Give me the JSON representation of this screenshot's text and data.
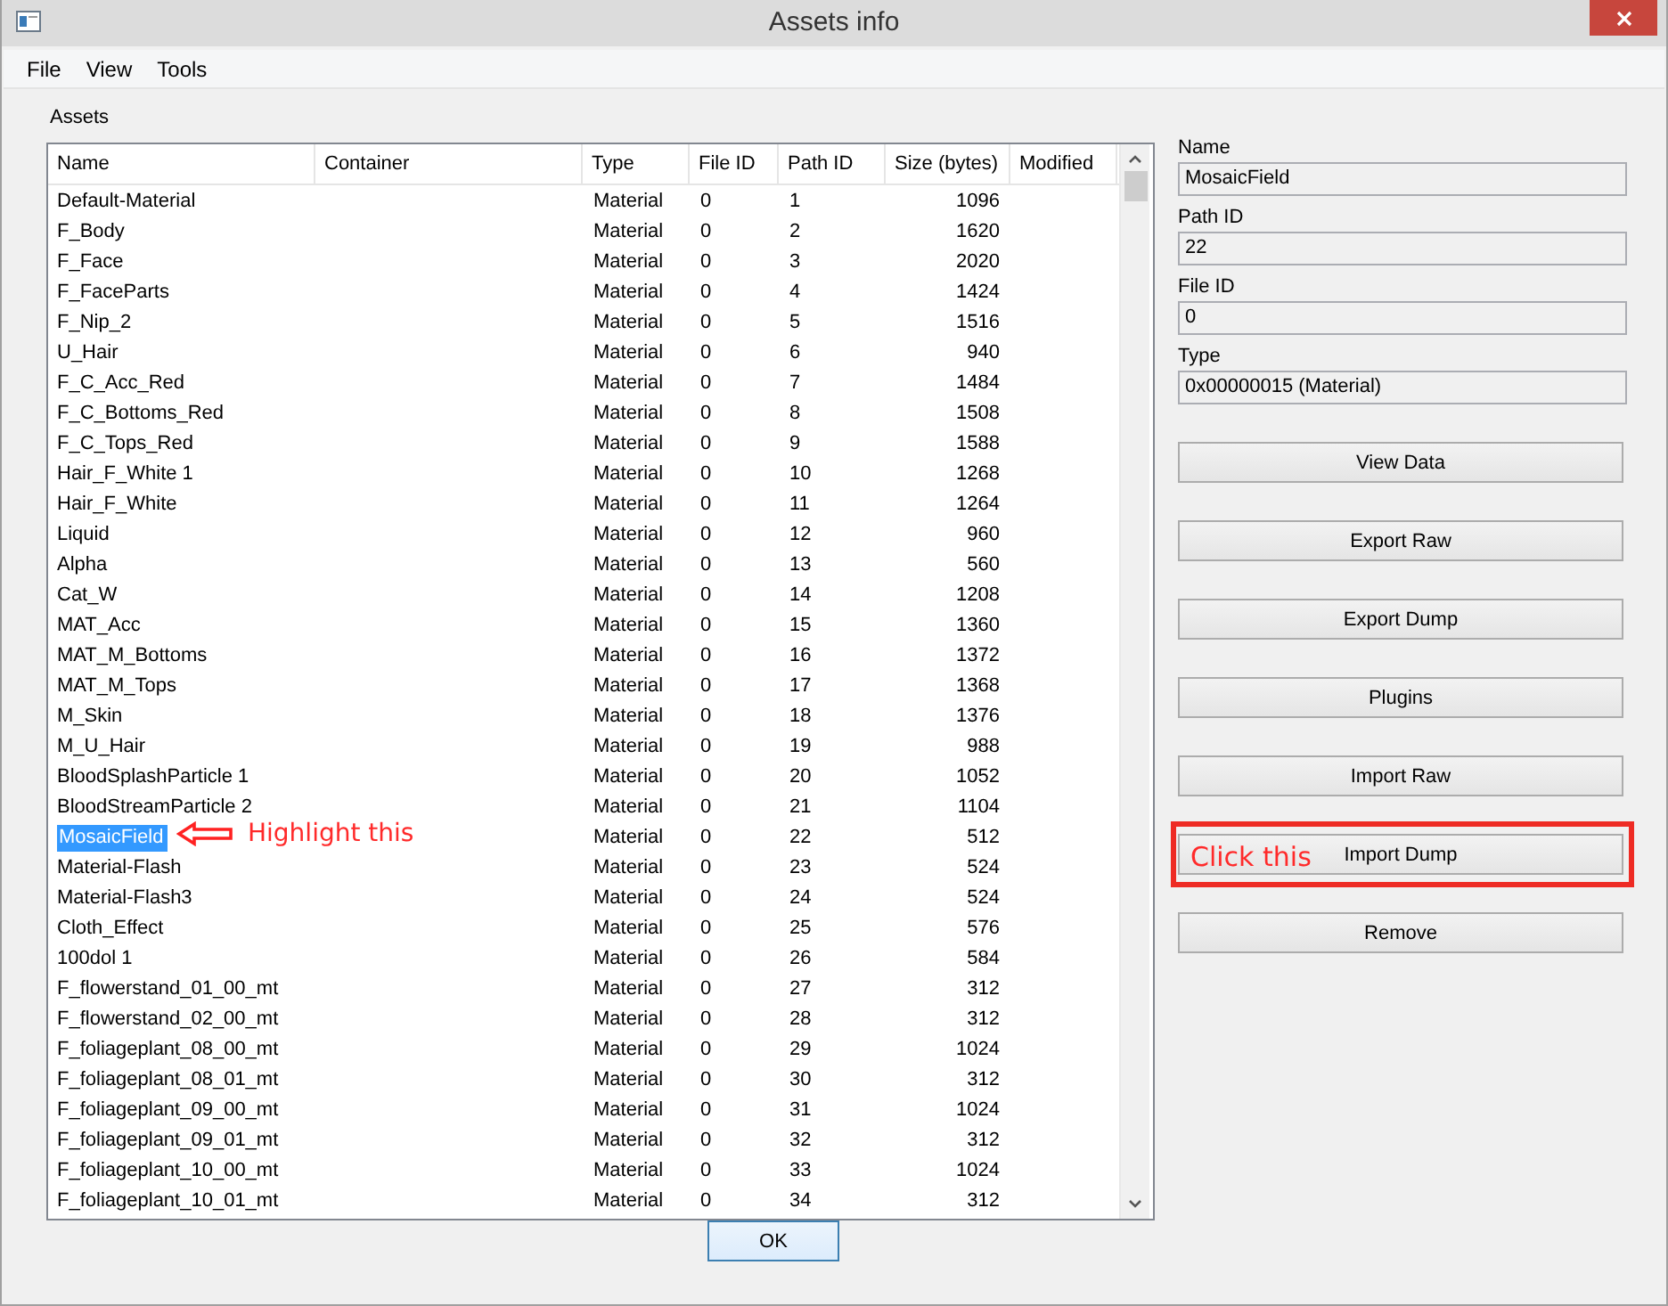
{
  "window": {
    "title": "Assets info"
  },
  "menu": [
    "File",
    "View",
    "Tools"
  ],
  "assets": {
    "label": "Assets",
    "columns": [
      "Name",
      "Container",
      "Type",
      "File ID",
      "Path ID",
      "Size (bytes)",
      "Modified"
    ],
    "rows": [
      {
        "name": "Default-Material",
        "type": "Material",
        "file_id": "0",
        "path_id": "1",
        "size": "1096",
        "selected": false
      },
      {
        "name": "F_Body",
        "type": "Material",
        "file_id": "0",
        "path_id": "2",
        "size": "1620",
        "selected": false
      },
      {
        "name": "F_Face",
        "type": "Material",
        "file_id": "0",
        "path_id": "3",
        "size": "2020",
        "selected": false
      },
      {
        "name": "F_FaceParts",
        "type": "Material",
        "file_id": "0",
        "path_id": "4",
        "size": "1424",
        "selected": false
      },
      {
        "name": "F_Nip_2",
        "type": "Material",
        "file_id": "0",
        "path_id": "5",
        "size": "1516",
        "selected": false
      },
      {
        "name": "U_Hair",
        "type": "Material",
        "file_id": "0",
        "path_id": "6",
        "size": "940",
        "selected": false
      },
      {
        "name": "F_C_Acc_Red",
        "type": "Material",
        "file_id": "0",
        "path_id": "7",
        "size": "1484",
        "selected": false
      },
      {
        "name": "F_C_Bottoms_Red",
        "type": "Material",
        "file_id": "0",
        "path_id": "8",
        "size": "1508",
        "selected": false
      },
      {
        "name": "F_C_Tops_Red",
        "type": "Material",
        "file_id": "0",
        "path_id": "9",
        "size": "1588",
        "selected": false
      },
      {
        "name": "Hair_F_White 1",
        "type": "Material",
        "file_id": "0",
        "path_id": "10",
        "size": "1268",
        "selected": false
      },
      {
        "name": "Hair_F_White",
        "type": "Material",
        "file_id": "0",
        "path_id": "11",
        "size": "1264",
        "selected": false
      },
      {
        "name": "Liquid",
        "type": "Material",
        "file_id": "0",
        "path_id": "12",
        "size": "960",
        "selected": false
      },
      {
        "name": "Alpha",
        "type": "Material",
        "file_id": "0",
        "path_id": "13",
        "size": "560",
        "selected": false
      },
      {
        "name": "Cat_W",
        "type": "Material",
        "file_id": "0",
        "path_id": "14",
        "size": "1208",
        "selected": false
      },
      {
        "name": "MAT_Acc",
        "type": "Material",
        "file_id": "0",
        "path_id": "15",
        "size": "1360",
        "selected": false
      },
      {
        "name": "MAT_M_Bottoms",
        "type": "Material",
        "file_id": "0",
        "path_id": "16",
        "size": "1372",
        "selected": false
      },
      {
        "name": "MAT_M_Tops",
        "type": "Material",
        "file_id": "0",
        "path_id": "17",
        "size": "1368",
        "selected": false
      },
      {
        "name": "M_Skin",
        "type": "Material",
        "file_id": "0",
        "path_id": "18",
        "size": "1376",
        "selected": false
      },
      {
        "name": "M_U_Hair",
        "type": "Material",
        "file_id": "0",
        "path_id": "19",
        "size": "988",
        "selected": false
      },
      {
        "name": "BloodSplashParticle 1",
        "type": "Material",
        "file_id": "0",
        "path_id": "20",
        "size": "1052",
        "selected": false
      },
      {
        "name": "BloodStreamParticle 2",
        "type": "Material",
        "file_id": "0",
        "path_id": "21",
        "size": "1104",
        "selected": false
      },
      {
        "name": "MosaicField",
        "type": "Material",
        "file_id": "0",
        "path_id": "22",
        "size": "512",
        "selected": true,
        "annotation": "Highlight this"
      },
      {
        "name": "Material-Flash",
        "type": "Material",
        "file_id": "0",
        "path_id": "23",
        "size": "524",
        "selected": false
      },
      {
        "name": "Material-Flash3",
        "type": "Material",
        "file_id": "0",
        "path_id": "24",
        "size": "524",
        "selected": false
      },
      {
        "name": "Cloth_Effect",
        "type": "Material",
        "file_id": "0",
        "path_id": "25",
        "size": "576",
        "selected": false
      },
      {
        "name": "100dol 1",
        "type": "Material",
        "file_id": "0",
        "path_id": "26",
        "size": "584",
        "selected": false
      },
      {
        "name": "F_flowerstand_01_00_mt",
        "type": "Material",
        "file_id": "0",
        "path_id": "27",
        "size": "312",
        "selected": false
      },
      {
        "name": "F_flowerstand_02_00_mt",
        "type": "Material",
        "file_id": "0",
        "path_id": "28",
        "size": "312",
        "selected": false
      },
      {
        "name": "F_foliageplant_08_00_mt",
        "type": "Material",
        "file_id": "0",
        "path_id": "29",
        "size": "1024",
        "selected": false
      },
      {
        "name": "F_foliageplant_08_01_mt",
        "type": "Material",
        "file_id": "0",
        "path_id": "30",
        "size": "312",
        "selected": false
      },
      {
        "name": "F_foliageplant_09_00_mt",
        "type": "Material",
        "file_id": "0",
        "path_id": "31",
        "size": "1024",
        "selected": false
      },
      {
        "name": "F_foliageplant_09_01_mt",
        "type": "Material",
        "file_id": "0",
        "path_id": "32",
        "size": "312",
        "selected": false
      },
      {
        "name": "F_foliageplant_10_00_mt",
        "type": "Material",
        "file_id": "0",
        "path_id": "33",
        "size": "1024",
        "selected": false
      },
      {
        "name": "F_foliageplant_10_01_mt",
        "type": "Material",
        "file_id": "0",
        "path_id": "34",
        "size": "312",
        "selected": false
      }
    ]
  },
  "details": [
    {
      "label": "Name",
      "value": "MosaicField"
    },
    {
      "label": "Path ID",
      "value": "22"
    },
    {
      "label": "File ID",
      "value": "0"
    },
    {
      "label": "Type",
      "value": "0x00000015 (Material)"
    }
  ],
  "actions": [
    {
      "label": "View Data"
    },
    {
      "label": "Export Raw"
    },
    {
      "label": "Export Dump"
    },
    {
      "label": "Plugins"
    },
    {
      "label": "Import Raw"
    },
    {
      "label": "Import Dump",
      "annotation": "Click this"
    },
    {
      "label": "Remove"
    }
  ],
  "ok_button": "OK"
}
